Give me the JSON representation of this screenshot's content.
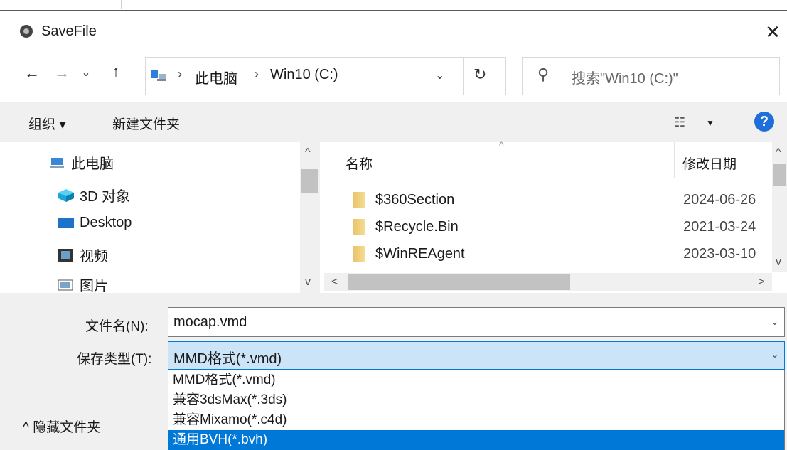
{
  "window": {
    "title": "SaveFile",
    "close_glyph": "✕"
  },
  "nav": {
    "back_glyph": "←",
    "forward_glyph": "→",
    "recent_glyph": "⌄",
    "up_glyph": "↑",
    "breadcrumb": [
      "此电脑",
      "Win10 (C:)"
    ],
    "separator": "›",
    "dropdown_glyph": "⌄",
    "refresh_glyph": "↻",
    "search_placeholder": "搜索\"Win10 (C:)\"",
    "search_glyph": "⚲"
  },
  "toolbar": {
    "organize_label": "组织 ▾",
    "new_folder_label": "新建文件夹",
    "view_glyph": "☷",
    "view_drop": "▼",
    "help_glyph": "?"
  },
  "tree": {
    "items": [
      {
        "label": "此电脑",
        "icon": "computer-icon"
      },
      {
        "label": "3D 对象",
        "icon": "3d-objects-icon"
      },
      {
        "label": "Desktop",
        "icon": "desktop-icon"
      },
      {
        "label": "视频",
        "icon": "video-icon"
      },
      {
        "label": "图片",
        "icon": "pictures-icon"
      }
    ],
    "scroll_up": "^",
    "scroll_down": "v"
  },
  "list": {
    "columns": {
      "name": "名称",
      "date": "修改日期"
    },
    "sort_caret": "^",
    "rows": [
      {
        "name": "$360Section",
        "date": "2024-06-26"
      },
      {
        "name": "$Recycle.Bin",
        "date": "2021-03-24"
      },
      {
        "name": "$WinREAgent",
        "date": "2023-03-10"
      }
    ],
    "scroll_up": "^",
    "scroll_down": "v",
    "scroll_left": "<",
    "scroll_right": ">"
  },
  "form": {
    "filename_label": "文件名(N):",
    "filename_value": "mocap.vmd",
    "filetype_label": "保存类型(T):",
    "filetype_value": "MMD格式(*.vmd)",
    "dropdown_glyph": "⌄",
    "filetype_options": [
      "MMD格式(*.vmd)",
      "兼容3dsMax(*.3ds)",
      "兼容Mixamo(*.c4d)",
      "通用BVH(*.bvh)"
    ],
    "selected_option_index": 3,
    "hide_folders_label": "^ 隐藏文件夹"
  },
  "colors": {
    "accent": "#0078d7",
    "selection_bg": "#cce4f7",
    "help": "#1e6fd9",
    "toolbar_bg": "#f0f0f0"
  }
}
